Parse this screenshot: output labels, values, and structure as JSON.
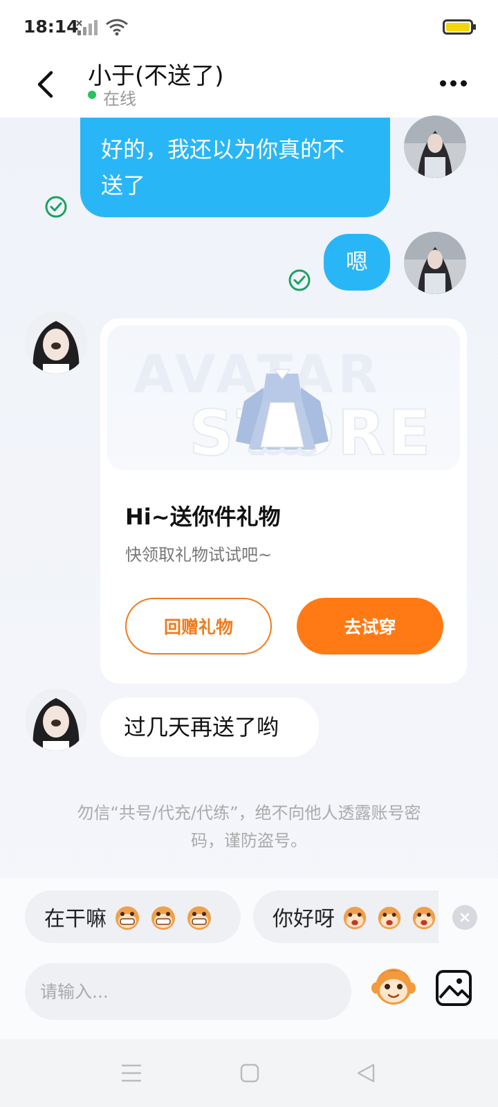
{
  "status_bar": {
    "time": "18:14"
  },
  "header": {
    "title": "小于(不送了)",
    "status": "在线"
  },
  "messages": [
    {
      "sender": "me",
      "text": "好的，我还以为你真的不送了",
      "line1": "好的，我还以为你真的不",
      "line2": "送了",
      "read": true
    },
    {
      "sender": "me",
      "text": "嗯",
      "read": true
    },
    {
      "sender": "other",
      "type": "gift",
      "gift": {
        "watermark_top": "AVATAR",
        "watermark_bottom": "STORE",
        "title": "Hi~送你件礼物",
        "subtitle": "快领取礼物试试吧~",
        "return_label": "回赠礼物",
        "try_on_label": "去试穿"
      }
    },
    {
      "sender": "other",
      "text": "过几天再送了哟"
    }
  ],
  "safety_notice": {
    "line1": "勿信“共号/代充/代练”，绝不向他人透露账号密",
    "line2": "码，谨防盗号。"
  },
  "quick_replies": [
    {
      "label": "在干嘛",
      "emoji": "grinning-monkey"
    },
    {
      "label": "你好呀",
      "emoji": "waving-monkey"
    }
  ],
  "composer": {
    "placeholder": "请输入..."
  },
  "colors": {
    "my_bubble": "#29b6f6",
    "accent_orange": "#ff7a14",
    "online": "#22c55e",
    "read_check": "#1aa260"
  }
}
